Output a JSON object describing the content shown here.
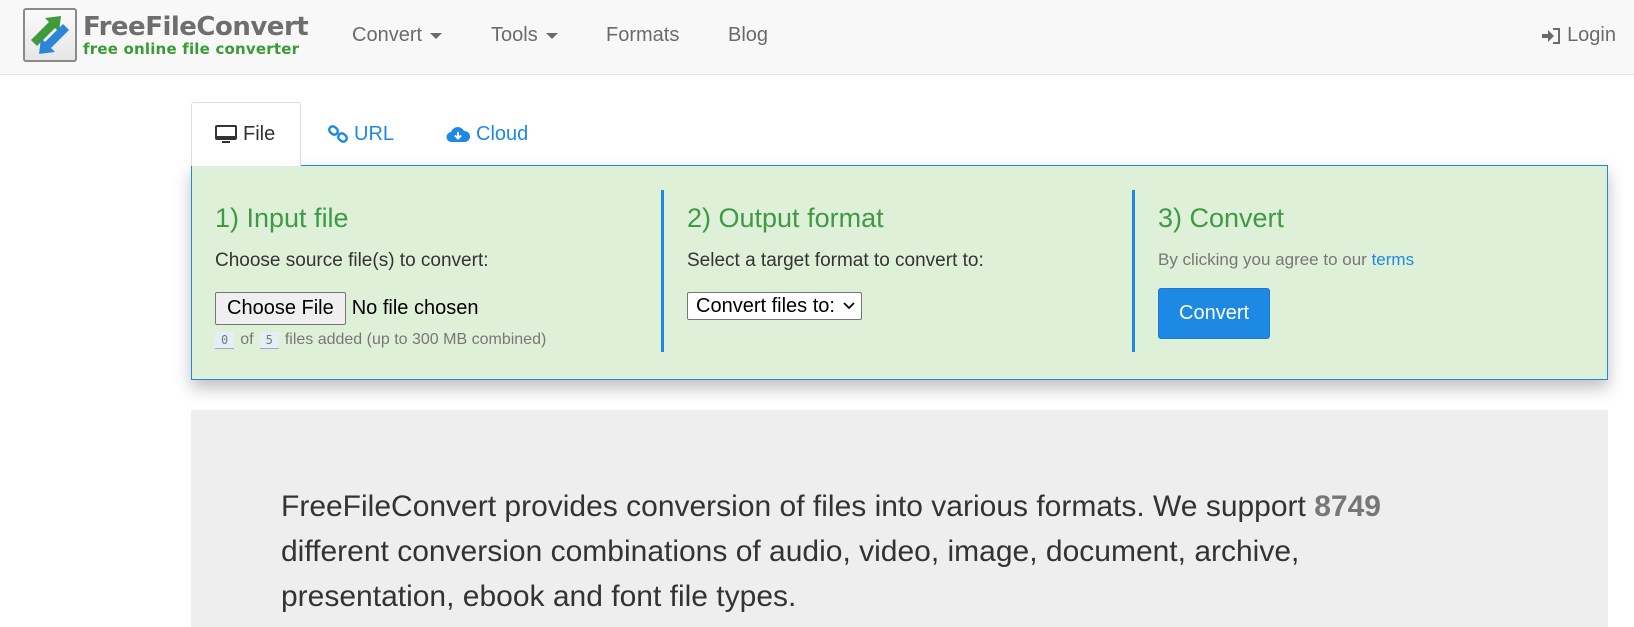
{
  "brand": {
    "title": "FreeFileConvert",
    "subtitle": "free online file converter"
  },
  "nav": {
    "items": [
      {
        "label": "Convert",
        "dropdown": true
      },
      {
        "label": "Tools",
        "dropdown": true
      },
      {
        "label": "Formats",
        "dropdown": false
      },
      {
        "label": "Blog",
        "dropdown": false
      }
    ],
    "login_label": "Login",
    "login_icon": "sign-in-icon"
  },
  "tabs": [
    {
      "label": "File",
      "icon": "desktop-icon",
      "active": true
    },
    {
      "label": "URL",
      "icon": "link-icon",
      "active": false
    },
    {
      "label": "Cloud",
      "icon": "cloud-download-icon",
      "active": false
    }
  ],
  "steps": {
    "input": {
      "title": "1) Input file",
      "description": "Choose source file(s) to convert:",
      "choose_button": "Choose File",
      "file_status": "No file chosen",
      "files_added": "0",
      "of_label": "of",
      "files_max": "5",
      "limit_text": "files added (up to 300 MB combined)"
    },
    "output": {
      "title": "2) Output format",
      "description": "Select a target format to convert to:",
      "select_value": "Convert files to:"
    },
    "convert": {
      "title": "3) Convert",
      "agree_text": "By clicking you agree to our",
      "terms_link": "terms",
      "button_label": "Convert"
    }
  },
  "info": {
    "text_before": "FreeFileConvert provides conversion of files into various formats. We support",
    "count": "8749",
    "text_after": "different conversion combinations of audio, video, image, document, archive, presentation, ebook and font file types."
  },
  "colors": {
    "accent": "#1e88e5",
    "step_title": "#3e9a45",
    "panel_bg": "#dff0d8",
    "brand_green": "#3a9a36"
  }
}
